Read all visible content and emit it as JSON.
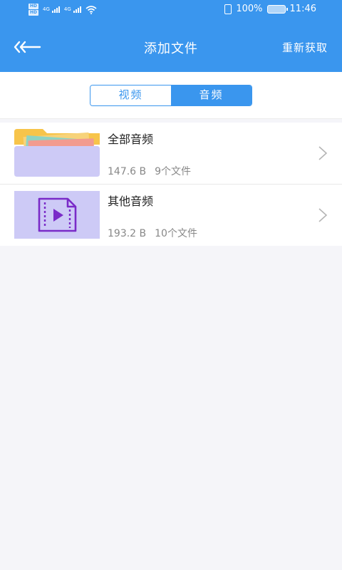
{
  "status": {
    "network_left": "4G",
    "network_right": "4G",
    "battery": "100%",
    "time": "11:46"
  },
  "header": {
    "title": "添加文件",
    "refresh_label": "重新获取"
  },
  "tabs": [
    {
      "label": "视频",
      "selected": false
    },
    {
      "label": "音频",
      "selected": true
    }
  ],
  "folders": [
    {
      "name": "全部音频",
      "size": "147.6 B",
      "count": "9个文件",
      "icon": "folder-icon"
    },
    {
      "name": "其他音频",
      "size": "193.2 B",
      "count": "10个文件",
      "icon": "media-file-icon"
    }
  ],
  "colors": {
    "accent": "#3a96ee",
    "thumb_bg": "#cdcaf6",
    "media_icon": "#7a2bc8"
  }
}
